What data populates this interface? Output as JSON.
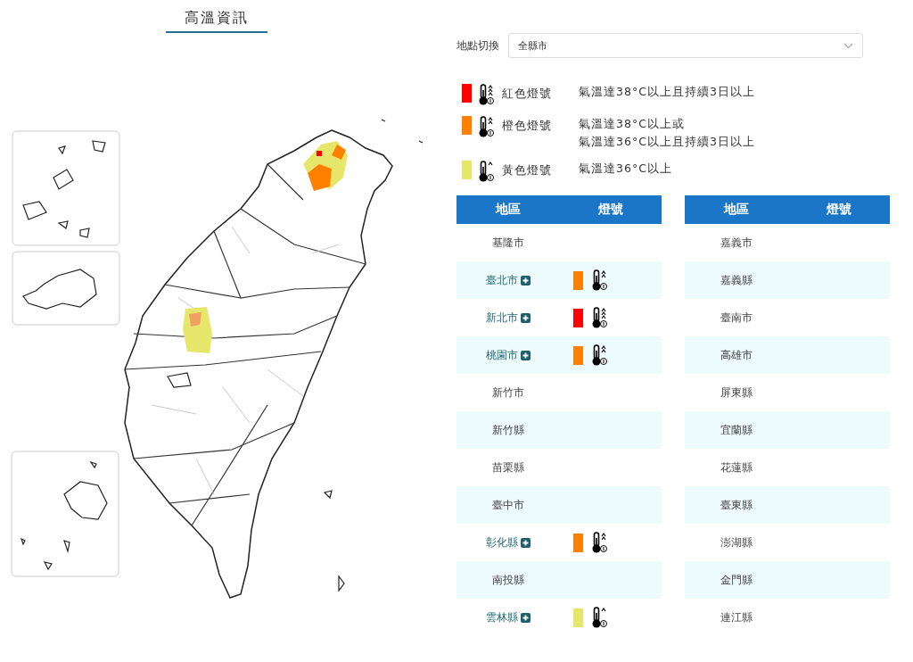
{
  "title": "高溫資訊",
  "location_switch": {
    "label": "地點切換",
    "value": "全縣市"
  },
  "legend": [
    {
      "kind": "red",
      "color": "#ff0000",
      "label": "紅色燈號",
      "lines": [
        "氣溫達38°C以上且持續3日以上"
      ]
    },
    {
      "kind": "orange",
      "color": "#ff8000",
      "label": "橙色燈號",
      "lines": [
        "氣溫達38°C以上或",
        "氣溫達36°C以上且持續3日以上"
      ]
    },
    {
      "kind": "yellow",
      "color": "#e6e66a",
      "label": "黃色燈號",
      "lines": [
        "氣溫達36°C以上"
      ]
    }
  ],
  "tables": [
    {
      "columns": [
        "地區",
        "燈號"
      ],
      "rows": [
        {
          "region": "基隆市",
          "expandable": false
        },
        {
          "region": "臺北市",
          "expandable": true,
          "kind": "orange",
          "color": "#ff8000"
        },
        {
          "region": "新北市",
          "expandable": true,
          "kind": "red",
          "color": "#ff0000"
        },
        {
          "region": "桃園市",
          "expandable": true,
          "kind": "orange",
          "color": "#ff8000"
        },
        {
          "region": "新竹市",
          "expandable": false
        },
        {
          "region": "新竹縣",
          "expandable": false
        },
        {
          "region": "苗栗縣",
          "expandable": false
        },
        {
          "region": "臺中市",
          "expandable": false
        },
        {
          "region": "彰化縣",
          "expandable": true,
          "kind": "orange",
          "color": "#ff8000"
        },
        {
          "region": "南投縣",
          "expandable": false
        },
        {
          "region": "雲林縣",
          "expandable": true,
          "kind": "yellow",
          "color": "#e6e66a"
        }
      ]
    },
    {
      "columns": [
        "地區",
        "燈號"
      ],
      "rows": [
        {
          "region": "嘉義市",
          "expandable": false
        },
        {
          "region": "嘉義縣",
          "expandable": false
        },
        {
          "region": "臺南市",
          "expandable": false
        },
        {
          "region": "高雄市",
          "expandable": false
        },
        {
          "region": "屏東縣",
          "expandable": false
        },
        {
          "region": "宜蘭縣",
          "expandable": false
        },
        {
          "region": "花蓮縣",
          "expandable": false
        },
        {
          "region": "臺東縣",
          "expandable": false
        },
        {
          "region": "澎湖縣",
          "expandable": false
        },
        {
          "region": "金門縣",
          "expandable": false
        },
        {
          "region": "連江縣",
          "expandable": false
        }
      ]
    }
  ]
}
